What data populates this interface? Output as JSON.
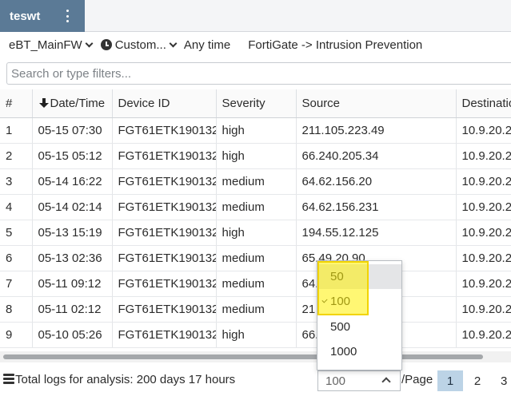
{
  "tab": {
    "label": "teswt"
  },
  "toolbar": {
    "device": "eBT_MainFW",
    "time_range": "Custom...",
    "time_value": "Any time",
    "view_path": "FortiGate -> Intrusion Prevention"
  },
  "search": {
    "placeholder": "Search or type filters..."
  },
  "table": {
    "columns": [
      "#",
      "Date/Time",
      "Device ID",
      "Severity",
      "Source",
      "Destinatio"
    ],
    "sorted_column": "Date/Time",
    "rows": [
      {
        "num": "1",
        "datetime": "05-15 07:30",
        "device": "FGT61ETK190132",
        "severity": "high",
        "source": "211.105.223.49",
        "dest": "10.9.20.2"
      },
      {
        "num": "2",
        "datetime": "05-15 05:12",
        "device": "FGT61ETK190132",
        "severity": "high",
        "source": "66.240.205.34",
        "dest": "10.9.20.2"
      },
      {
        "num": "3",
        "datetime": "05-14 16:22",
        "device": "FGT61ETK190132",
        "severity": "medium",
        "source": "64.62.156.20",
        "dest": "10.9.20.2"
      },
      {
        "num": "4",
        "datetime": "05-14 02:14",
        "device": "FGT61ETK190132",
        "severity": "medium",
        "source": "64.62.156.231",
        "dest": "10.9.20.2"
      },
      {
        "num": "5",
        "datetime": "05-13 15:19",
        "device": "FGT61ETK190132",
        "severity": "high",
        "source": "194.55.12.125",
        "dest": "10.9.20.2"
      },
      {
        "num": "6",
        "datetime": "05-13 02:36",
        "device": "FGT61ETK190132",
        "severity": "medium",
        "source": "65.49.20.90",
        "dest": "10.9.20.2"
      },
      {
        "num": "7",
        "datetime": "05-11 09:12",
        "device": "FGT61ETK190132",
        "severity": "medium",
        "source": "64.",
        "dest": "10.9.20.2"
      },
      {
        "num": "8",
        "datetime": "05-11 02:12",
        "device": "FGT61ETK190132",
        "severity": "medium",
        "source": "21",
        "dest": "10.9.20.2"
      },
      {
        "num": "9",
        "datetime": "05-10 05:26",
        "device": "FGT61ETK190132",
        "severity": "high",
        "source": "66.",
        "dest": "10.9.20.2"
      }
    ]
  },
  "footer": {
    "summary": "Total logs for analysis: 200 days 17 hours",
    "page_size": "100",
    "per_page": "/Page",
    "pages": [
      "1",
      "2",
      "3"
    ],
    "current_page": "1"
  },
  "dropdown": {
    "options": [
      "50",
      "100",
      "500",
      "1000"
    ],
    "selected": "100"
  },
  "colors": {
    "tab_bg": "#5b7a96",
    "active_page_bg": "#bcd3e6",
    "highlight": "#fff100"
  }
}
